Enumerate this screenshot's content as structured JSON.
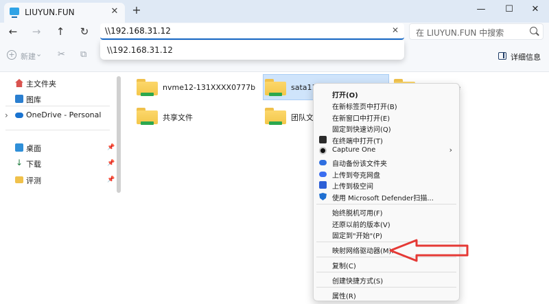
{
  "window": {
    "tab_title": "LIUYUN.FUN",
    "tab_close": "✕",
    "new_tab": "+",
    "minimize": "—",
    "maximize": "☐",
    "close": "✕"
  },
  "nav": {
    "back": "←",
    "forward": "→",
    "up": "↑",
    "refresh": "↻",
    "address_value": "\\\\192.168.31.12",
    "address_clear": "✕",
    "search_placeholder": "在 LIUYUN.FUN 中搜索"
  },
  "suggestion": "\\\\192.168.31.12",
  "commandbar": {
    "new_label": "新建",
    "new_caret": "⌄",
    "details_label": "详细信息"
  },
  "sidebar": {
    "items": [
      {
        "label": "主文件夹",
        "icon": "home-icon",
        "color": "#d9534f"
      },
      {
        "label": "图库",
        "icon": "gallery-icon",
        "color": "#2b7fd0"
      },
      {
        "label": "OneDrive - Personal",
        "icon": "onedrive-icon",
        "color": "#1a73d0",
        "expand": "›"
      }
    ],
    "pinned": [
      {
        "label": "桌面",
        "icon": "desktop-icon",
        "color": "#2f8fd8",
        "pin": "📌"
      },
      {
        "label": "下载",
        "icon": "download-icon",
        "color": "#1c7a3c",
        "pin": "📌"
      },
      {
        "label": "评测",
        "icon": "folder-icon",
        "color": "#f0c14b",
        "pin": "📌"
      }
    ]
  },
  "folders": [
    {
      "label": "nvme12-131XXXX0777b"
    },
    {
      "label": "sata11-131XXXX0777b"
    },
    {
      "label": "sharetome"
    },
    {
      "label": "共享文件"
    },
    {
      "label": "团队文件"
    }
  ],
  "context_menu": {
    "items": [
      {
        "label": "打开(O)",
        "bold": true
      },
      {
        "label": "在新标签页中打开(B)"
      },
      {
        "label": "在新窗口中打开(E)"
      },
      {
        "label": "固定到快速访问(Q)"
      },
      {
        "label": "在终端中打开(T)",
        "icon": "terminal-icon"
      },
      {
        "label": "Capture One",
        "icon": "capture-one-icon",
        "submenu": "›"
      },
      {
        "label": "自动备份该文件夹",
        "icon": "cloud-backup-icon"
      },
      {
        "label": "上传到夸克网盘",
        "icon": "quark-cloud-icon"
      },
      {
        "label": "上传到极空间",
        "icon": "zspace-icon"
      },
      {
        "label": "使用 Microsoft Defender扫描...",
        "icon": "defender-shield-icon"
      },
      {
        "label": "始终脱机可用(F)"
      },
      {
        "label": "还原以前的版本(V)"
      },
      {
        "label": "固定到\"开始\"(P)"
      },
      {
        "label": "映射网络驱动器(M)..."
      },
      {
        "label": "复制(C)"
      },
      {
        "label": "创建快捷方式(S)"
      },
      {
        "label": "属性(R)"
      }
    ]
  },
  "colors": {
    "accent": "#1669c8",
    "annotation_arrow": "#e53935",
    "selection": "#cfe4fb"
  }
}
